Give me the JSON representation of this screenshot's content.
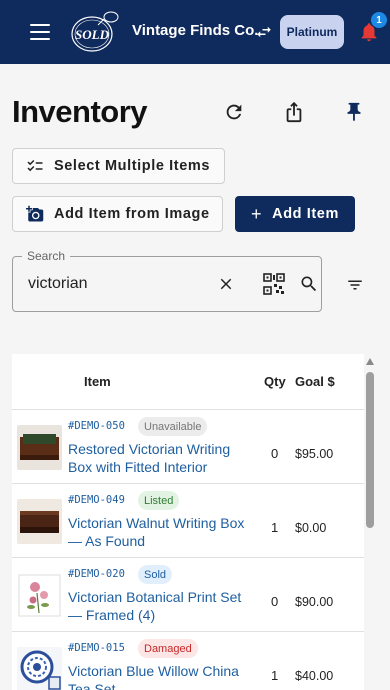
{
  "app": {
    "brand": "Vintage Finds Co.",
    "tier": "Platinum",
    "notifications": "1",
    "logo_text": "SOLD"
  },
  "page": {
    "title": "Inventory",
    "select_multiple_label": "Select Multiple Items",
    "add_from_image_label": "Add Item from Image",
    "add_item_label": "Add Item"
  },
  "search": {
    "legend": "Search",
    "value": "victorian"
  },
  "table": {
    "columns": [
      "Item",
      "Qty",
      "Goal $"
    ],
    "rows": [
      {
        "sku": "#DEMO-050",
        "status": "Unavailable",
        "name": "Restored Victorian Writing Box with Fitted Interior",
        "qty": "0",
        "goal": "$95.00"
      },
      {
        "sku": "#DEMO-049",
        "status": "Listed",
        "name": "Victorian Walnut Writing Box — As Found",
        "qty": "1",
        "goal": "$0.00"
      },
      {
        "sku": "#DEMO-020",
        "status": "Sold",
        "name": "Victorian Botanical Print Set — Framed (4)",
        "qty": "0",
        "goal": "$90.00"
      },
      {
        "sku": "#DEMO-015",
        "status": "Damaged",
        "name": "Victorian Blue Willow China Tea Set",
        "qty": "1",
        "goal": "$40.00"
      }
    ]
  },
  "colors": {
    "topbar": "#0f2a5c",
    "link": "#1f5fa0",
    "status_unavailable_bg": "#ececec",
    "status_listed_bg": "#e3f3e3",
    "status_sold_bg": "#e1eefb",
    "status_damaged_bg": "#fde6e6"
  }
}
